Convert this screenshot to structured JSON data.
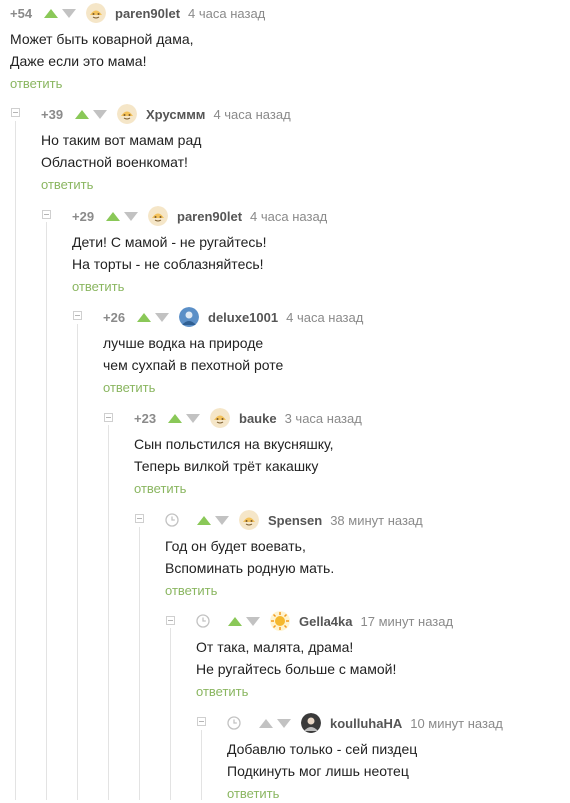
{
  "colors": {
    "accent_green": "#8ac858",
    "reply_green": "#8ab660",
    "muted": "#8a8a8a",
    "thread_line": "#e3e3e3"
  },
  "comments": [
    {
      "rating": "+54",
      "author": "paren90let",
      "time": "4 часа назад",
      "lines": [
        "Может быть коварной дама,",
        "Даже если это мама!"
      ],
      "reply": "ответить",
      "avatar": "pikabu-default-avatar"
    },
    {
      "rating": "+39",
      "author": "Хрусммм",
      "time": "4 часа назад",
      "lines": [
        "Но таким вот мамам рад",
        "Областной военкомат!"
      ],
      "reply": "ответить",
      "avatar": "pikabu-default-avatar"
    },
    {
      "rating": "+29",
      "author": "paren90let",
      "time": "4 часа назад",
      "lines": [
        "Дети! С мамой - не ругайтесь!",
        "На торты - не соблазняйтесь!"
      ],
      "reply": "ответить",
      "avatar": "pikabu-default-avatar"
    },
    {
      "rating": "+26",
      "author": "deluxe1001",
      "time": "4 часа назад",
      "lines": [
        "лучше водка на природе",
        "чем сухпай в пехотной роте"
      ],
      "reply": "ответить",
      "avatar": "photo-avatar"
    },
    {
      "rating": "+23",
      "author": "bauke",
      "time": "3 часа назад",
      "lines": [
        "Сын польстился на вкусняшку,",
        "Теперь вилкой трёт какашку"
      ],
      "reply": "ответить",
      "avatar": "pikabu-default-avatar"
    },
    {
      "rating": "",
      "author": "Spensen",
      "time": "38 минут назад",
      "lines": [
        "Год он будет воевать,",
        "Вспоминать родную мать."
      ],
      "reply": "ответить",
      "avatar": "pikabu-default-avatar"
    },
    {
      "rating": "",
      "author": "Gella4ka",
      "time": "17 минут назад",
      "lines": [
        "От така, малята, драма!",
        "Не ругайтесь больше с мамой!"
      ],
      "reply": "ответить",
      "avatar": "sun-avatar"
    },
    {
      "rating": "",
      "author": "koulluhaHA",
      "time": "10 минут назад",
      "lines": [
        "Добавлю только - сей пиздец",
        "Подкинуть мог лишь неотец"
      ],
      "reply": "ответить",
      "avatar": "photo-avatar"
    }
  ]
}
